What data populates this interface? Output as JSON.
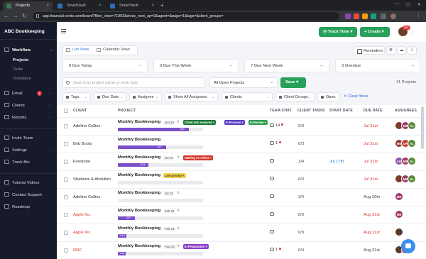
{
  "browser": {
    "tabs": [
      "Projects",
      "SmartVault",
      "SmartVault"
    ],
    "url": "app.financial-cents.com/board?filter_view=71992&show_next_up=0&agent=&page=1&tags=&client_groups="
  },
  "sidebar": {
    "brand": "ABC Bookkeeping",
    "workflow": "Workflow",
    "sub": [
      "Projects",
      "Tasks",
      "Templates"
    ],
    "items": [
      "Email",
      "Clients",
      "Reports",
      "Invite Team",
      "Settings",
      "Trash Bin",
      "Tutorial Videos",
      "Contact Support",
      "Roadmap"
    ],
    "email_badge": "1"
  },
  "header": {
    "track_time": "Track Time",
    "create": "Create",
    "notif_badge": "99+"
  },
  "views": {
    "list": "List View",
    "calendar": "Calendar View"
  },
  "reminders": "Reminders",
  "cards": [
    "0  Due Today",
    "0  Due This Week",
    "7  Due Next Week",
    "3  Overdue"
  ],
  "search": {
    "placeholder": "Search by project name or work type"
  },
  "project_filter": "All Open Projects",
  "save": "Save",
  "count": "41 Projects",
  "filters": [
    "Tags",
    "Due Date",
    "Assignee",
    "Show All Assignees",
    "Clients",
    "Client Groups",
    "Open"
  ],
  "clear_filters": "Clear filters",
  "columns": [
    "CLIENT",
    "PROJECT",
    "TEAM CHAT",
    "CLIENT TASKS",
    "START DATE",
    "DUE DATE",
    "ASSIGNEES"
  ],
  "rows": [
    {
      "client": "Adeline Collins",
      "project": "Monthly Bookkeeping",
      "date": "Jun 23",
      "tags": [
        "Client info received",
        "In Process",
        "In Review"
      ],
      "progress": "5/6",
      "fill": 0.83,
      "chat": "14",
      "tasks": "0/3",
      "start": "",
      "due": "Jul 31st",
      "due_color": "red"
    },
    {
      "client": "Bob Boots",
      "project": "Monthly Bookkeeping",
      "date": "",
      "tags": [],
      "progress": "4/7",
      "fill": 0.57,
      "chat": "1",
      "tasks": "0/3",
      "start": "",
      "due": "Jul 31st",
      "due_color": "red"
    },
    {
      "client": "Firestone",
      "project": "Monthly Bookkeeping",
      "date": "Jul 23",
      "tags": [
        "Waiting on Client"
      ],
      "progress": "4/11",
      "fill": 0.36,
      "chat": "",
      "tasks": "1/4",
      "start": "Jul 17th",
      "due": "Jul 31st",
      "due_color": "red"
    },
    {
      "client": "Shabram & Abdullah",
      "project": "Monthly Bookkeeping",
      "date": "",
      "tags": [
        "Low priority"
      ],
      "progress": "",
      "fill": 0,
      "chat": "",
      "tasks": "0/3",
      "start": "",
      "due": "Jul 31st",
      "due_color": "red"
    },
    {
      "client": "Adeline Collins",
      "project": "Monthly Bookkeeping",
      "date": "Jul 23",
      "tags": [],
      "progress": "0/6",
      "fill": 0.0,
      "chat": "",
      "tasks": "3/4",
      "start": "",
      "due": "Aug 30th",
      "due_color": "gray"
    },
    {
      "client": "Apple Inc.",
      "project": "Monthly Bookkeeping",
      "date": "Feb 22",
      "tags": [],
      "progress": "1/5",
      "fill": 0.2,
      "chat": "",
      "tasks": "0/3",
      "start": "",
      "due": "Aug 31st",
      "due_color": "red"
    },
    {
      "client": "Apple Inc.",
      "project": "Monthly Bookkeeping",
      "date": "Feb 23",
      "tags": [],
      "progress": "1/10",
      "fill": 0.1,
      "chat": "",
      "tasks": "0/3",
      "start": "",
      "due": "Aug 31st",
      "due_color": "red"
    },
    {
      "client": "DRC",
      "project": "Monthly Bookkeeping",
      "date": "Aug 23",
      "tags": [
        "In Preparation"
      ],
      "progress": "1/11",
      "fill": 0.09,
      "chat": "1",
      "tasks": "0/4",
      "start": "",
      "due": "Aug 31st",
      "due_color": "gray"
    }
  ],
  "colors": {
    "green": "#27a15a",
    "purple": "#7b4fc9",
    "red": "#d9342b",
    "blue": "#2c6bd6",
    "sidebar_bg": "#161a2b"
  }
}
